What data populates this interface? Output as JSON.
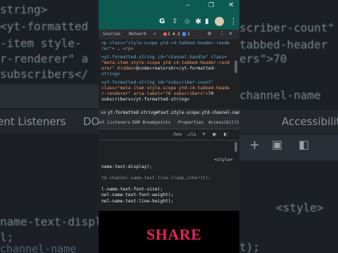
{
  "background_left": {
    "lines": [
      "string>",
      "<yt-formatted",
      "-item style-",
      "r-renderer\" a",
      "subscribers</"
    ],
    "tabs": [
      "ent Listeners",
      "DO"
    ],
    "style_lines": [
      "name-text-displa",
      "l;",
      "channel-name"
    ]
  },
  "background_right": {
    "lines": [
      "scriber-count\"",
      "tabbed-header",
      "ers\">70",
      "channel-name"
    ],
    "tab": "Accessibility",
    "style_tag": "<style>",
    "style_line": "t);"
  },
  "window": {
    "titlebar_icons": [
      "minimize-icon",
      "restore-icon",
      "close-icon"
    ],
    "toolbar_icons": [
      "google-icon",
      "share-icon",
      "star-icon",
      "extension-icon",
      "sidebar-icon",
      "profile-avatar",
      "menu-icon"
    ]
  },
  "devtools": {
    "tabs": [
      "Sources",
      "Network"
    ],
    "badges": {
      "errors": "1",
      "warnings": "2",
      "info": "1"
    },
    "elements_code": [
      {
        "tag": "<p class=\"style-scope ytd-c4-tabbed-header-rende",
        "rest": ""
      },
      {
        "tag": "rer\">",
        "rest": " … </p>"
      },
      {
        "tag": "<yt-formatted-string id=\"channel-handle\" class=",
        "rest": ""
      },
      {
        "tag": "\"meta-item style-scope ytd-c4-tabbed-header-rend",
        "rest": ""
      },
      {
        "tag": "erer\" hidden>",
        "rest": "@codecreatorskr</yt-formatted-"
      },
      {
        "tag": "string>",
        "rest": ""
      },
      {
        "tag": "<yt-formatted-string id=\"subscriber-count\"",
        "rest": ""
      },
      {
        "tag": "class=\"meta-item style-scope ytd-c4-tabbed-heade",
        "rest": ""
      },
      {
        "tag": "r-renderer\" aria-label=\"70 subscribers\">",
        "rest": "70"
      },
      {
        "tag": "subscribers</yt-formatted-string>",
        "rest": ""
      }
    ],
    "breadcrumbs": [
      "ve",
      "yt-formatted-string#text.style-scope.ytd-channel-name"
    ],
    "subtabs": [
      "ent Listeners",
      "DOM Breakpoints",
      "Properties",
      "Accessibility"
    ],
    "filter": {
      "hov": ":hov",
      "cls": ".cls"
    },
    "styles": {
      "source": "<style>",
      "lines": [
        "name-text-display);",
        "td-channel-name-text-line-clamp,inherit);",
        "l-name-text-font-size);",
        "nel-name-text-font-weight);",
        "nel-name-text-line-height);"
      ]
    }
  },
  "caption": "SHARE"
}
